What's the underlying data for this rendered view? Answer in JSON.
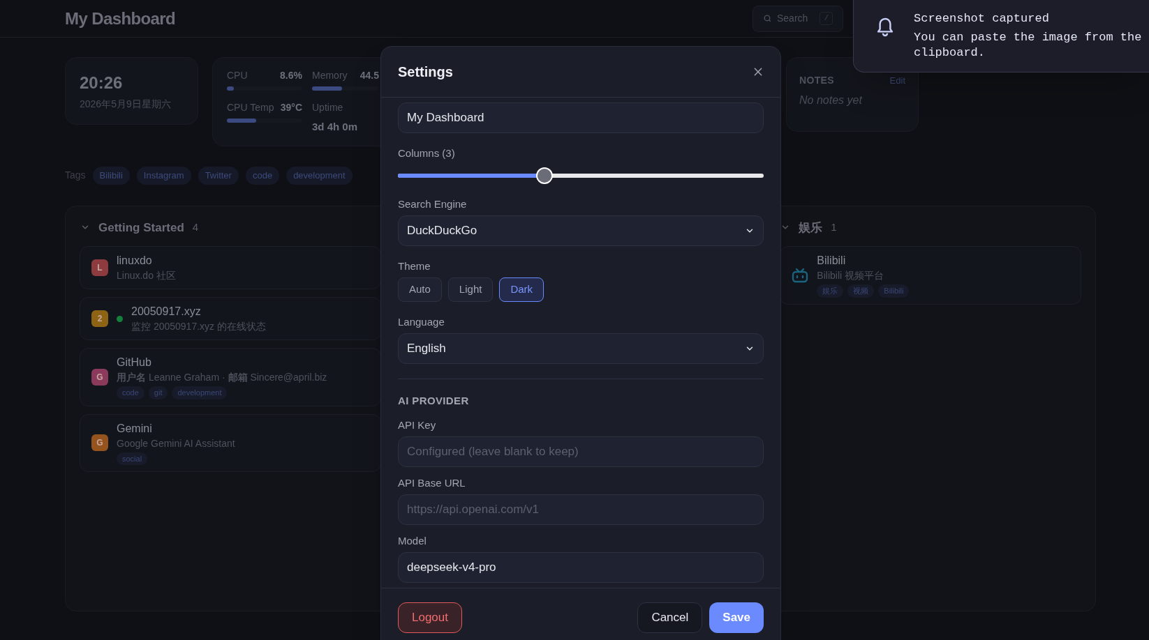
{
  "header": {
    "title": "My Dashboard",
    "search": {
      "placeholder": "Search",
      "shortcut": "/"
    }
  },
  "widgets": {
    "clock": {
      "time": "20:26",
      "date": "2026年5月9日星期六"
    },
    "stats": [
      {
        "kind": "bar",
        "label": "CPU",
        "reading": "8.6%",
        "level": 0.09
      },
      {
        "kind": "bar",
        "label": "Memory",
        "reading": "44.5",
        "level": 0.45
      },
      {
        "kind": "bar",
        "label": "CPU Temp",
        "reading": "39°C",
        "level": 0.39
      },
      {
        "kind": "text",
        "label": "Uptime",
        "reading": "3d 4h 0m"
      }
    ],
    "notes": {
      "title": "NOTES",
      "action": "Edit",
      "empty_text": "No notes yet"
    }
  },
  "tags": {
    "label": "Tags",
    "items": [
      "Bilibili",
      "Instagram",
      "Twitter",
      "code",
      "development"
    ]
  },
  "groups": [
    {
      "title": "Getting Started",
      "count": "4",
      "expanded": true,
      "bookmarks": [
        {
          "kind": "letter",
          "initial": "L",
          "color": "#8e3b40",
          "name": "linuxdo",
          "description": "Linux.do 社区",
          "online": false
        },
        {
          "kind": "letter",
          "initial": "2",
          "color": "#8c6414",
          "name": "20050917.xyz",
          "description": "监控 20050917.xyz 的在线状态",
          "online": true
        },
        {
          "kind": "letter",
          "initial": "G",
          "color": "#8c3a5c",
          "name": "GitHub",
          "description": "**用户名** Leanne Graham · **邮箱** Sincere@april.biz",
          "online": false,
          "tags": [
            "code",
            "git",
            "development"
          ]
        },
        {
          "kind": "letter",
          "initial": "G",
          "color": "#95541d",
          "name": "Gemini",
          "description": "Google Gemini AI Assistant",
          "online": false,
          "tags": [
            "social"
          ]
        }
      ]
    },
    {
      "title": "娱乐",
      "count": "1",
      "expanded": true,
      "bookmarks": [
        {
          "kind": "icon",
          "name": "Bilibili",
          "description": "Bilibili 视频平台",
          "online": false,
          "tags": [
            "娱乐",
            "视频",
            "Bilibili"
          ]
        }
      ]
    }
  ],
  "settings": {
    "title": "Settings",
    "fields": [
      {
        "kind": "text",
        "value": "My Dashboard"
      },
      {
        "kind": "slider",
        "label": "Columns (3)",
        "level": 0.4
      },
      {
        "kind": "select",
        "label": "Search Engine",
        "value": "DuckDuckGo"
      },
      {
        "kind": "segmented",
        "label": "Theme",
        "options": [
          {
            "label": "Auto",
            "selected": false
          },
          {
            "label": "Light",
            "selected": false
          },
          {
            "label": "Dark",
            "selected": true
          }
        ]
      },
      {
        "kind": "select",
        "label": "Language",
        "value": "English"
      },
      {
        "kind": "heading",
        "label": "AI PROVIDER"
      },
      {
        "kind": "text",
        "label": "API Key",
        "placeholder": "Configured (leave blank to keep)"
      },
      {
        "kind": "text",
        "label": "API Base URL",
        "placeholder": "https://api.openai.com/v1"
      },
      {
        "kind": "text",
        "label": "Model",
        "value": "deepseek-v4-pro"
      }
    ],
    "buttons": [
      {
        "kind": "danger",
        "label": "Logout"
      },
      {
        "kind": "secondary",
        "label": "Cancel"
      },
      {
        "kind": "primary",
        "label": "Save"
      }
    ]
  },
  "toast": {
    "title": "Screenshot captured",
    "message": "You can paste the image from the clipboard."
  }
}
